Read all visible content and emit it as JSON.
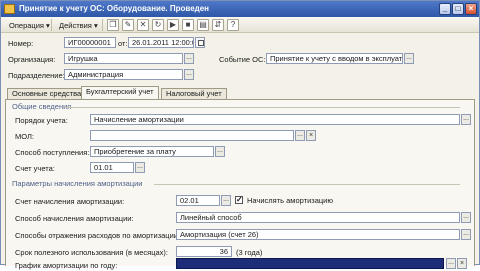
{
  "window": {
    "title": "Принятие к учету ОС: Оборудование. Проведен",
    "controls": {
      "minimize": "_",
      "maximize": "□",
      "close": "×"
    }
  },
  "toolbar": {
    "operation": "Операция ▾",
    "actions": "Действия ▾",
    "icon_help": "?"
  },
  "header": {
    "number_label": "Номер:",
    "number_value": "ИГ00000001",
    "date_sep": "от:",
    "date_value": "26.01.2011 12:00:00",
    "org_label": "Организация:",
    "org_value": "Игрушка",
    "dept_label": "Подразделение:",
    "dept_value": "Администрация",
    "event_label": "Событие ОС:",
    "event_value": "Принятие к учету с вводом в эксплуатаци"
  },
  "tabs": [
    {
      "label": "Основные средства"
    },
    {
      "label": "Бухгалтерский учет"
    },
    {
      "label": "Налоговый учет"
    }
  ],
  "general": {
    "heading": "Общие сведения",
    "order_label": "Порядок учета:",
    "order_value": "Начисление амортизации",
    "mol_label": "МОЛ:",
    "mol_value": "",
    "receipt_label": "Способ поступления:",
    "receipt_value": "Приобретение за плату",
    "account_label": "Счет учета:",
    "account_value": "01.01"
  },
  "amort": {
    "heading": "Параметры начисления амортизации",
    "acc_label": "Счет начисления амортизации:",
    "acc_value": "02.01",
    "charge_label": "Начислять амортизацию",
    "charge_checked": "✓",
    "method_label": "Способ начисления амортизации:",
    "method_value": "Линейный способ",
    "expense_label": "Способы отражения расходов по амортизации:",
    "expense_value": "Амортизация (счет 26)",
    "life_label": "Срок полезного использования (в месяцах):",
    "life_value": "36",
    "life_years": "(3 года)",
    "schedule_label": "График амортизации по году:"
  }
}
